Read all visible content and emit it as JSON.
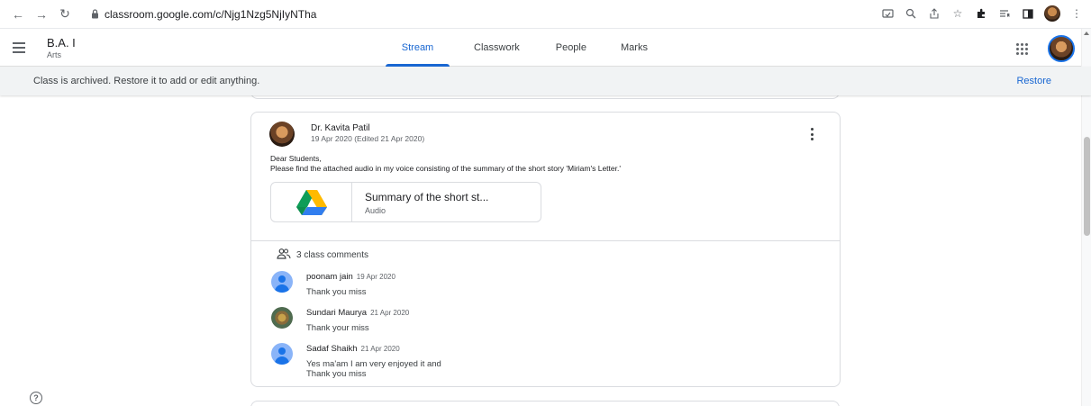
{
  "browser": {
    "url": "classroom.google.com/c/Njg1Nzg5NjIyNTha"
  },
  "header": {
    "class_name": "B.A. I",
    "class_section": "Arts",
    "tabs": [
      {
        "label": "Stream",
        "active": true
      },
      {
        "label": "Classwork",
        "active": false
      },
      {
        "label": "People",
        "active": false
      },
      {
        "label": "Marks",
        "active": false
      }
    ]
  },
  "banner": {
    "message": "Class is archived. Restore it to add or edit anything.",
    "action": "Restore"
  },
  "post": {
    "author": "Dr. Kavita Patil",
    "date": "19 Apr 2020 (Edited 21 Apr 2020)",
    "body_line1": "Dear Students,",
    "body_line2": "Please find the attached audio in my voice consisting of the summary of the short story 'Miriam's Letter.'",
    "attachment": {
      "title": "Summary of the short st...",
      "type": "Audio",
      "icon": "google-drive-icon"
    },
    "comments_count_label": "3 class comments",
    "comments": [
      {
        "name": "poonam jain",
        "date": "19 Apr 2020",
        "text_lines": [
          "Thank you miss"
        ],
        "avatar": "default-person"
      },
      {
        "name": "Sundari Maurya",
        "date": "21 Apr 2020",
        "text_lines": [
          "Thank your miss"
        ],
        "avatar": "photo"
      },
      {
        "name": "Sadaf Shaikh",
        "date": "21 Apr 2020",
        "text_lines": [
          "Yes ma'am I am very enjoyed it and",
          "Thank you miss"
        ],
        "avatar": "default-person"
      }
    ]
  },
  "help": {
    "symbol": "?"
  },
  "colors": {
    "accent": "#1967d2",
    "banner_bg": "#f1f3f4",
    "border": "#dadce0"
  }
}
